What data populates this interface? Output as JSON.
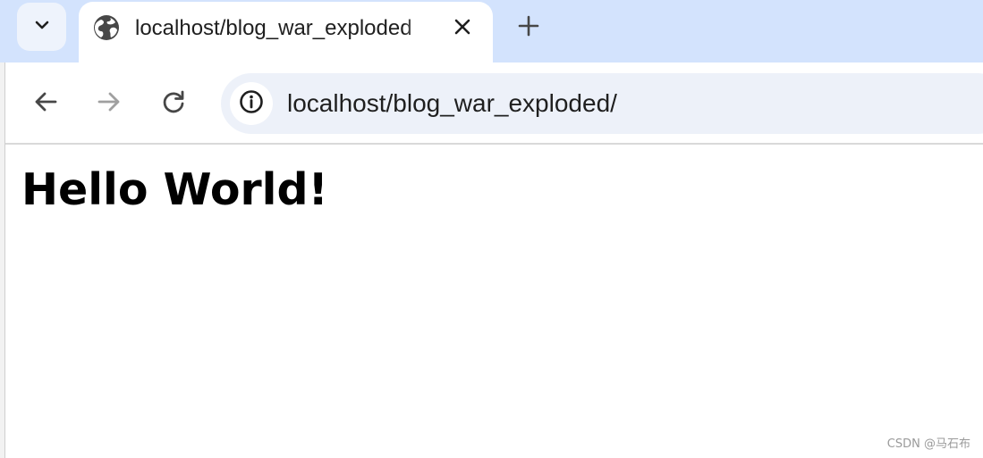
{
  "browser": {
    "tab": {
      "title": "localhost/blog_war_exploded"
    },
    "icons": {
      "tab_search": "chevron-down-icon",
      "favicon": "globe-icon",
      "close": "close-icon",
      "new_tab": "plus-icon",
      "back": "arrow-left-icon",
      "forward": "arrow-right-icon",
      "reload": "reload-icon",
      "site_info": "info-icon"
    },
    "address_bar": {
      "url": "localhost/blog_war_exploded/"
    },
    "colors": {
      "tabstrip": "#d3e3fd",
      "omnibox": "#edf1f9",
      "icon": "#474747",
      "icon_disabled": "#a0a0a0"
    }
  },
  "page": {
    "heading": "Hello World!"
  },
  "watermark": {
    "text": "CSDN @马石布"
  }
}
